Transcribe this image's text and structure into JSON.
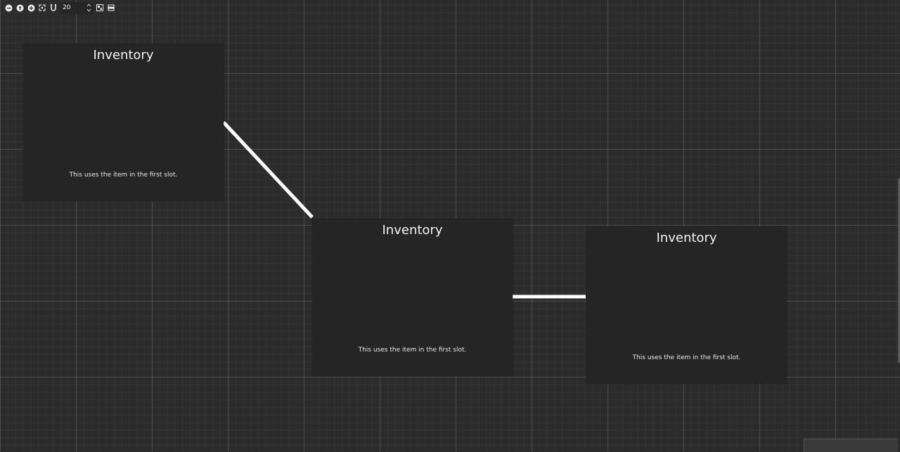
{
  "toolbar": {
    "zoom_out_icon": "zoom-out-icon",
    "reset_zoom_icon": "reset-zoom-icon",
    "zoom_in_icon": "zoom-in-icon",
    "snap_icon": "snap-grid-icon",
    "auto_arrange_icon": "magnet-icon",
    "zoom_value": "20",
    "minimap_icon": "minimap-icon",
    "layout_icon": "layout-icon"
  },
  "nodes": [
    {
      "title": "Inventory",
      "text": "This uses the item in the first slot."
    },
    {
      "title": "Inventory",
      "text": "This uses the item in the first slot."
    },
    {
      "title": "Inventory",
      "text": "This uses the item in the first slot."
    }
  ],
  "colors": {
    "background": "#2b2b2b",
    "node": "#252525",
    "connection": "#ffffff"
  }
}
